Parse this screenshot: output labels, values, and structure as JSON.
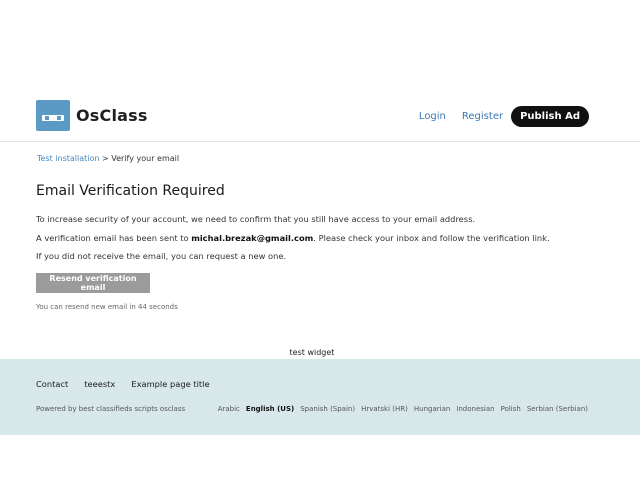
{
  "header": {
    "logo_text": "OsClass",
    "nav": {
      "login": "Login",
      "register": "Register",
      "publish": "Publish Ad"
    }
  },
  "breadcrumb": {
    "home": "Test installation",
    "separator": ">",
    "current": "Verify your email"
  },
  "main": {
    "title": "Email Verification Required",
    "p1": "To increase security of your account, we need to confirm that you still have access to your email address.",
    "p2_before": "A verification email has been sent to ",
    "p2_email": "michal.brezak@gmail.com",
    "p2_after": ". Please check your inbox and follow the verification link.",
    "p3": "If you did not receive the email, you can request a new one.",
    "resend_button": "Resend verification email",
    "countdown": "You can resend new email in 44 seconds"
  },
  "widget": "test widget",
  "footer": {
    "links": [
      "Contact",
      "teeestx",
      "Example page title"
    ],
    "powered": "Powered by best classifieds scripts osclass",
    "languages": [
      "Arabic",
      "English (US)",
      "Spanish (Spain)",
      "Hrvatski (HR)",
      "Hungarian",
      "Indonesian",
      "Polish",
      "Serbian (Serbian)"
    ],
    "active_language": "English (US)"
  },
  "colors": {
    "brand_blue": "#5b9ac4",
    "link_blue": "#3b78b5",
    "footer_bg": "#d8e8ea",
    "button_gray": "#9b9b9b"
  }
}
